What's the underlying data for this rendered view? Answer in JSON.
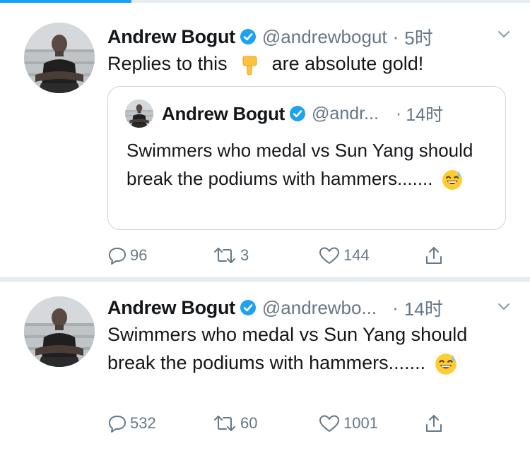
{
  "tweets": [
    {
      "author": {
        "name": "Andrew Bogut",
        "handle": "@andrewbogut",
        "time": "5时"
      },
      "text_before": "Replies to this",
      "text_after": "are absolute gold!",
      "emoji": "pointing-down-hand",
      "quote": {
        "author": {
          "name": "Andrew Bogut",
          "handle": "@andr...",
          "time": "14时"
        },
        "text": "Swimmers who medal vs Sun Yang should break the podiums with hammers.......",
        "emoji": "grinning-sweat-face"
      },
      "stats": {
        "replies": "96",
        "retweets": "3",
        "likes": "144"
      }
    },
    {
      "author": {
        "name": "Andrew Bogut",
        "handle": "@andrewbo...",
        "time": "14时"
      },
      "text": "Swimmers who medal vs Sun Yang should break the podiums with hammers.......",
      "emoji": "grinning-sweat-face",
      "stats": {
        "replies": "532",
        "retweets": "60",
        "likes": "1001"
      }
    }
  ],
  "colors": {
    "accent": "#1da1f2",
    "text": "#14171a",
    "muted": "#657786",
    "border": "#ccd6dd"
  },
  "icons": [
    "verified-badge-icon",
    "chevron-down-icon",
    "reply-icon",
    "retweet-icon",
    "like-icon",
    "share-icon"
  ]
}
